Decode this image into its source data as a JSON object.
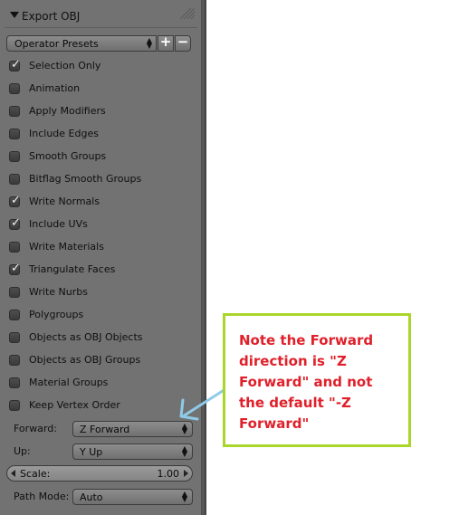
{
  "panel": {
    "title": "Export OBJ",
    "presets_label": "Operator Presets",
    "add_label": "+",
    "remove_label": "−"
  },
  "options": [
    {
      "label": "Selection Only",
      "checked": true
    },
    {
      "label": "Animation",
      "checked": false
    },
    {
      "label": "Apply Modifiers",
      "checked": false
    },
    {
      "label": "Include Edges",
      "checked": false
    },
    {
      "label": "Smooth Groups",
      "checked": false
    },
    {
      "label": "Bitflag Smooth Groups",
      "checked": false
    },
    {
      "label": "Write Normals",
      "checked": true
    },
    {
      "label": "Include UVs",
      "checked": true
    },
    {
      "label": "Write Materials",
      "checked": false
    },
    {
      "label": "Triangulate Faces",
      "checked": true
    },
    {
      "label": "Write Nurbs",
      "checked": false
    },
    {
      "label": "Polygroups",
      "checked": false
    },
    {
      "label": "Objects as OBJ Objects",
      "checked": false
    },
    {
      "label": "Objects as OBJ Groups",
      "checked": false
    },
    {
      "label": "Material Groups",
      "checked": false
    },
    {
      "label": "Keep Vertex Order",
      "checked": false
    }
  ],
  "forward": {
    "label": "Forward:",
    "value": "Z Forward"
  },
  "up": {
    "label": "Up:",
    "value": "Y Up"
  },
  "scale": {
    "label": "Scale:",
    "value": "1.00"
  },
  "path_mode": {
    "label": "Path Mode:",
    "value": "Auto"
  },
  "annotation": {
    "text": "Note the Forward direction is \"Z Forward\" and not the default \"-Z Forward\"",
    "text_color": "#e0202a",
    "border_color": "#aad62a",
    "arrow_color": "#8ecbe8"
  },
  "colors": {
    "panel_bg": "#727272"
  }
}
